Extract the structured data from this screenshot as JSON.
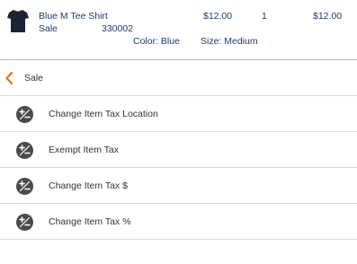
{
  "cart_item": {
    "name": "Blue M Tee Shirt",
    "type": "Sale",
    "sku": "330002",
    "price": "$12.00",
    "quantity": "1",
    "total": "$12.00",
    "color": "Color: Blue",
    "size": "Size: Medium",
    "thumbnail_icon": "tshirt-thumbnail-icon"
  },
  "back": {
    "label": "Sale",
    "icon": "chevron-left-icon"
  },
  "menu": {
    "items": [
      {
        "label": "Change Item Tax Location",
        "icon": "plus-minus-icon"
      },
      {
        "label": "Exempt Item Tax",
        "icon": "plus-minus-icon"
      },
      {
        "label": "Change Item Tax $",
        "icon": "plus-minus-icon"
      },
      {
        "label": "Change Item Tax %",
        "icon": "plus-minus-icon"
      }
    ]
  },
  "colors": {
    "item_text": "#1e3a6e",
    "accent": "#e8731f",
    "icon_circle": "#4a4a4a"
  }
}
